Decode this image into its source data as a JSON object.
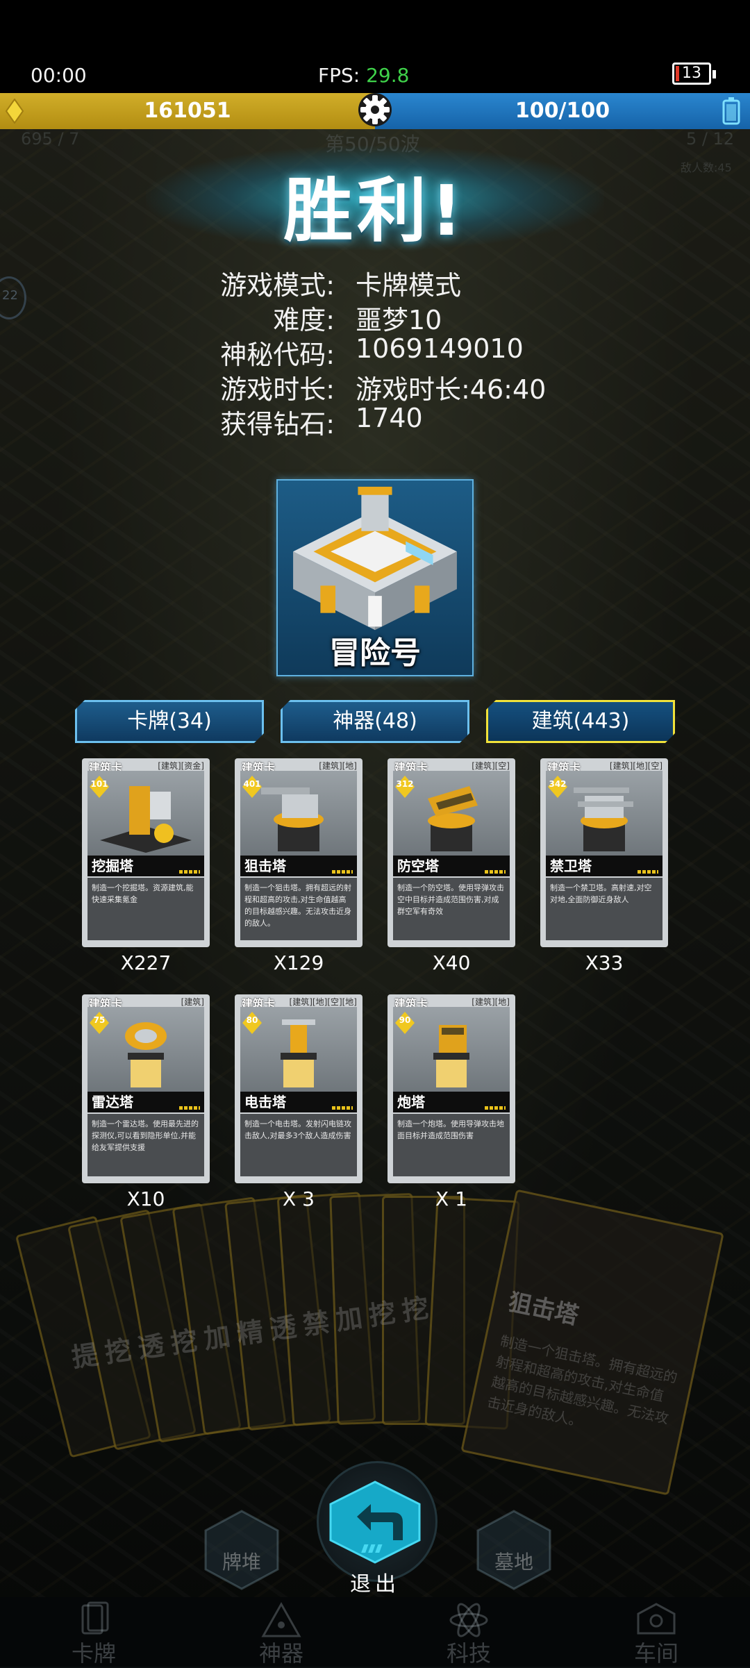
{
  "status": {
    "time": "00:00",
    "fps_label": "FPS:",
    "fps_value": "29.8",
    "battery_level": "13"
  },
  "resources": {
    "gold": "161051",
    "energy": "100/100",
    "gold_color": "#c9a421",
    "energy_color": "#2279c2"
  },
  "background_hud": {
    "left": "695 / 7",
    "wave": "第50/50波",
    "right": "5 / 12",
    "enemies": "敌人数:45",
    "side_badge": "22"
  },
  "result": {
    "title": "胜利!"
  },
  "stats": [
    {
      "label": "游戏模式:",
      "value": "卡牌模式"
    },
    {
      "label": "难度:",
      "value": "噩梦10"
    },
    {
      "label": "神秘代码:",
      "value": "1069149010"
    },
    {
      "label": "游戏时长:",
      "value": "游戏时长:46:40"
    },
    {
      "label": "获得钻石:",
      "value": "1740"
    }
  ],
  "hero": {
    "name": "冒险号"
  },
  "tabs": [
    {
      "label": "卡牌(34)",
      "active": false
    },
    {
      "label": "神器(48)",
      "active": false
    },
    {
      "label": "建筑(443)",
      "active": true
    }
  ],
  "cards": [
    {
      "type": "建筑卡",
      "tags": "[建筑][资金]",
      "cost": "101",
      "name": "挖掘塔",
      "desc": "制造一个挖掘塔。资源建筑,能快速采集氪金",
      "count": "X227"
    },
    {
      "type": "建筑卡",
      "tags": "[建筑][地]",
      "cost": "401",
      "name": "狙击塔",
      "desc": "制造一个狙击塔。拥有超远的射程和超高的攻击,对生命值越高的目标越感兴趣。无法攻击近身的敌人。",
      "count": "X129"
    },
    {
      "type": "建筑卡",
      "tags": "[建筑][空]",
      "cost": "312",
      "name": "防空塔",
      "desc": "制造一个防空塔。使用导弹攻击空中目标并造成范围伤害,对成群空军有奇效",
      "count": "X40"
    },
    {
      "type": "建筑卡",
      "tags": "[建筑][地][空]",
      "cost": "342",
      "name": "禁卫塔",
      "desc": "制造一个禁卫塔。高射速,对空对地,全面防御近身敌人",
      "count": "X33"
    },
    {
      "type": "建筑卡",
      "tags": "[建筑]",
      "cost": "75",
      "name": "雷达塔",
      "desc": "制造一个雷达塔。使用最先进的探测仪,可以看到隐形单位,并能给友军提供支援",
      "count": "X10"
    },
    {
      "type": "建筑卡",
      "tags": "[建筑][地][空][地]",
      "cost": "80",
      "name": "电击塔",
      "desc": "制造一个电击塔。发射闪电链攻击敌人,对最多3个敌人造成伤害",
      "count": "X 3"
    },
    {
      "type": "建筑卡",
      "tags": "[建筑][地]",
      "cost": "90",
      "name": "炮塔",
      "desc": "制造一个炮塔。使用导弹攻击地面目标并造成范围伤害",
      "count": "X 1"
    }
  ],
  "background_fan": {
    "labels": [
      "提",
      "挖",
      "透",
      "挖",
      "加",
      "精",
      "透",
      "禁",
      "加",
      "挖",
      "挖"
    ],
    "big_card_name": "狙击塔",
    "big_card_desc": "制造一个狙击塔。拥有超远的射程和超高的攻击,对生命值越高的目标越感兴趣。无法攻击近身的敌人。"
  },
  "exit": {
    "label": "退出",
    "left_label": "牌堆",
    "right_label": "墓地"
  },
  "bottom_nav": [
    {
      "label": "卡牌"
    },
    {
      "label": "神器"
    },
    {
      "label": "科技"
    },
    {
      "label": "车间"
    }
  ]
}
